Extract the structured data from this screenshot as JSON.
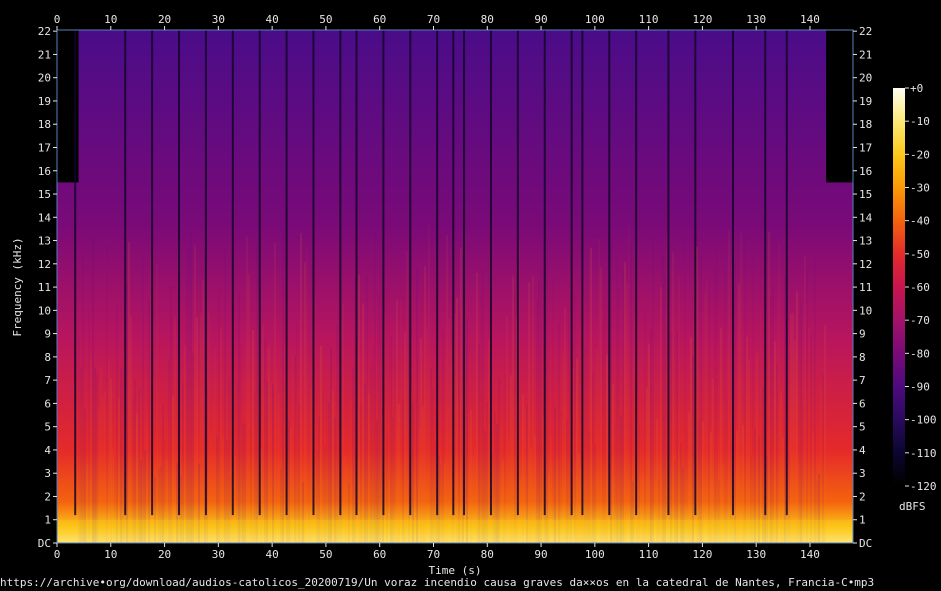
{
  "chart_data": {
    "type": "heatmap",
    "xlabel": "Time (s)",
    "ylabel": "Frequency (kHz)",
    "xlim": [
      0,
      148
    ],
    "ylim": [
      0,
      22.05
    ],
    "x_ticks": [
      0,
      10,
      20,
      30,
      40,
      50,
      60,
      70,
      80,
      90,
      100,
      110,
      120,
      130,
      140
    ],
    "y_ticks": [
      "DC",
      "1",
      "2",
      "3",
      "4",
      "5",
      "6",
      "7",
      "8",
      "9",
      "10",
      "11",
      "12",
      "13",
      "14",
      "15",
      "16",
      "17",
      "18",
      "19",
      "20",
      "21",
      "22"
    ],
    "colorbar": {
      "label": "dBFS",
      "ticks": [
        "+0",
        "-10",
        "-20",
        "-30",
        "-40",
        "-50",
        "-60",
        "-70",
        "-80",
        "-90",
        "-100",
        "-110",
        "-120"
      ],
      "range": [
        -120,
        0
      ],
      "colors": [
        "#000000",
        "#0b0630",
        "#2a0a5e",
        "#4e0a7e",
        "#7a0a78",
        "#a3126a",
        "#c8154f",
        "#e52a2a",
        "#f4630e",
        "#fb9a06",
        "#fcc81a",
        "#fce978",
        "#fffff0"
      ]
    },
    "regions": {
      "intro_lowpass_end_s": 4,
      "outro_lowpass_start_s": 143,
      "lowpass_cutoff_khz": 15.5,
      "gaps_s": [
        3.2,
        12.5,
        17.5,
        22.5,
        27.5,
        32.5,
        37.5,
        42.5,
        47.5,
        52.5,
        55.5,
        60.5,
        65.5,
        70.5,
        73.5,
        75.5,
        80.5,
        85.5,
        90.5,
        95.5,
        97.5,
        102.5,
        107.5,
        113.5,
        118.5,
        125.5,
        131.5,
        135.5
      ]
    }
  },
  "source": "https://archive•org/download/audios-catolicos_20200719/Un voraz incendio causa graves da××os en la catedral de Nantes, Francia-C•mp3"
}
